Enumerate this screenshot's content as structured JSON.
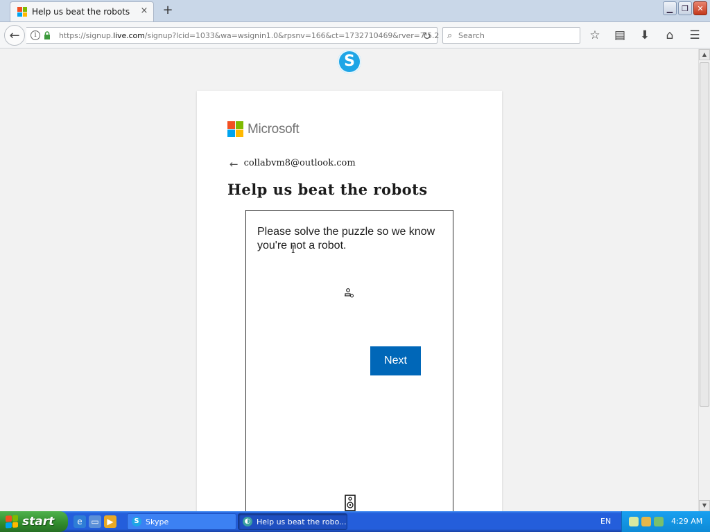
{
  "browser": {
    "tab_title": "Help us beat the robots",
    "tab_close": "×",
    "new_tab": "+",
    "url_prefix": "https://signup.",
    "url_domain": "live.com",
    "url_rest": "/signup?lcid=1033&wa=wsignin1.0&rpsnv=166&ct=1732710469&rver=7.5.2",
    "search_placeholder": "Search"
  },
  "page": {
    "brand": "Microsoft",
    "email": "collabvm8@outlook.com",
    "heading": "Help us beat the robots",
    "puzzle_prompt": "Please solve the puzzle so we know you're not a robot.",
    "next_label": "Next"
  },
  "taskbar": {
    "start_label": "start",
    "items": [
      {
        "label": "Skype"
      },
      {
        "label": "Help us beat the robo..."
      }
    ],
    "language": "EN",
    "clock": "4:29 AM"
  },
  "colors": {
    "accent": "#0067b8",
    "skype": "#1ea5e6",
    "ms_red": "#f25022",
    "ms_green": "#7fba00",
    "ms_blue": "#00a4ef",
    "ms_yellow": "#ffb900"
  }
}
